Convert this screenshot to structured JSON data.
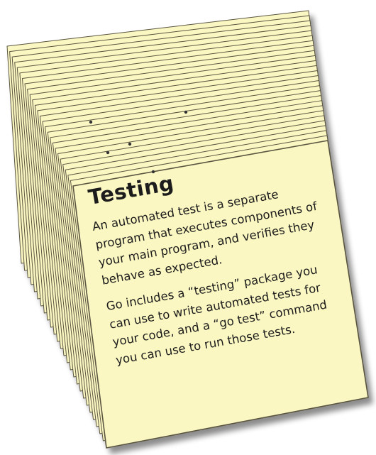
{
  "note": {
    "title": "Testing",
    "paragraphs": [
      {
        "lines": [
          "An automated test is a separate",
          "program that executes components of",
          "your main program, and verifies they",
          "behave as expected."
        ]
      },
      {
        "lines": [
          "Go includes a “testing” package you",
          "can use to write automated tests for",
          "your code, and a “go test” command",
          "you can use to run those tests."
        ]
      }
    ]
  },
  "colors": {
    "card_fill": "#fbf7c2",
    "card_edge": "#5a5540",
    "text": "#1c1c1c"
  }
}
